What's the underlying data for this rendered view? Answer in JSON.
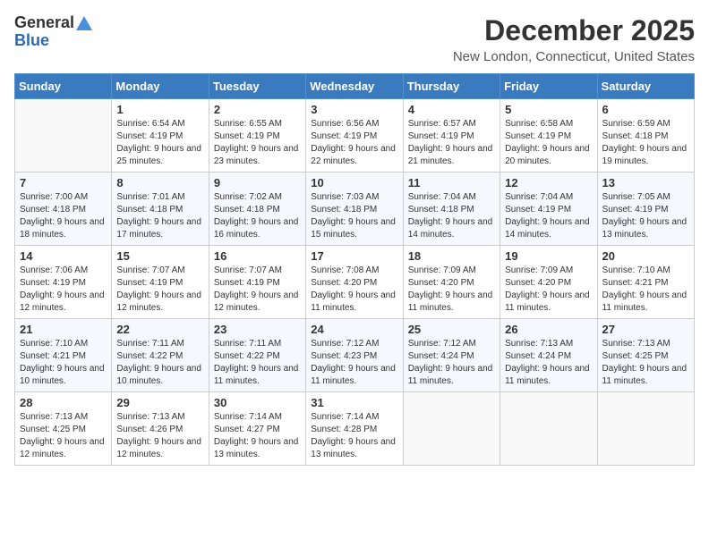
{
  "logo": {
    "general": "General",
    "blue": "Blue"
  },
  "header": {
    "title": "December 2025",
    "location": "New London, Connecticut, United States"
  },
  "weekdays": [
    "Sunday",
    "Monday",
    "Tuesday",
    "Wednesday",
    "Thursday",
    "Friday",
    "Saturday"
  ],
  "weeks": [
    [
      {
        "day": "",
        "sunrise": "",
        "sunset": "",
        "daylight": ""
      },
      {
        "day": "1",
        "sunrise": "Sunrise: 6:54 AM",
        "sunset": "Sunset: 4:19 PM",
        "daylight": "Daylight: 9 hours and 25 minutes."
      },
      {
        "day": "2",
        "sunrise": "Sunrise: 6:55 AM",
        "sunset": "Sunset: 4:19 PM",
        "daylight": "Daylight: 9 hours and 23 minutes."
      },
      {
        "day": "3",
        "sunrise": "Sunrise: 6:56 AM",
        "sunset": "Sunset: 4:19 PM",
        "daylight": "Daylight: 9 hours and 22 minutes."
      },
      {
        "day": "4",
        "sunrise": "Sunrise: 6:57 AM",
        "sunset": "Sunset: 4:19 PM",
        "daylight": "Daylight: 9 hours and 21 minutes."
      },
      {
        "day": "5",
        "sunrise": "Sunrise: 6:58 AM",
        "sunset": "Sunset: 4:19 PM",
        "daylight": "Daylight: 9 hours and 20 minutes."
      },
      {
        "day": "6",
        "sunrise": "Sunrise: 6:59 AM",
        "sunset": "Sunset: 4:18 PM",
        "daylight": "Daylight: 9 hours and 19 minutes."
      }
    ],
    [
      {
        "day": "7",
        "sunrise": "Sunrise: 7:00 AM",
        "sunset": "Sunset: 4:18 PM",
        "daylight": "Daylight: 9 hours and 18 minutes."
      },
      {
        "day": "8",
        "sunrise": "Sunrise: 7:01 AM",
        "sunset": "Sunset: 4:18 PM",
        "daylight": "Daylight: 9 hours and 17 minutes."
      },
      {
        "day": "9",
        "sunrise": "Sunrise: 7:02 AM",
        "sunset": "Sunset: 4:18 PM",
        "daylight": "Daylight: 9 hours and 16 minutes."
      },
      {
        "day": "10",
        "sunrise": "Sunrise: 7:03 AM",
        "sunset": "Sunset: 4:18 PM",
        "daylight": "Daylight: 9 hours and 15 minutes."
      },
      {
        "day": "11",
        "sunrise": "Sunrise: 7:04 AM",
        "sunset": "Sunset: 4:18 PM",
        "daylight": "Daylight: 9 hours and 14 minutes."
      },
      {
        "day": "12",
        "sunrise": "Sunrise: 7:04 AM",
        "sunset": "Sunset: 4:19 PM",
        "daylight": "Daylight: 9 hours and 14 minutes."
      },
      {
        "day": "13",
        "sunrise": "Sunrise: 7:05 AM",
        "sunset": "Sunset: 4:19 PM",
        "daylight": "Daylight: 9 hours and 13 minutes."
      }
    ],
    [
      {
        "day": "14",
        "sunrise": "Sunrise: 7:06 AM",
        "sunset": "Sunset: 4:19 PM",
        "daylight": "Daylight: 9 hours and 12 minutes."
      },
      {
        "day": "15",
        "sunrise": "Sunrise: 7:07 AM",
        "sunset": "Sunset: 4:19 PM",
        "daylight": "Daylight: 9 hours and 12 minutes."
      },
      {
        "day": "16",
        "sunrise": "Sunrise: 7:07 AM",
        "sunset": "Sunset: 4:19 PM",
        "daylight": "Daylight: 9 hours and 12 minutes."
      },
      {
        "day": "17",
        "sunrise": "Sunrise: 7:08 AM",
        "sunset": "Sunset: 4:20 PM",
        "daylight": "Daylight: 9 hours and 11 minutes."
      },
      {
        "day": "18",
        "sunrise": "Sunrise: 7:09 AM",
        "sunset": "Sunset: 4:20 PM",
        "daylight": "Daylight: 9 hours and 11 minutes."
      },
      {
        "day": "19",
        "sunrise": "Sunrise: 7:09 AM",
        "sunset": "Sunset: 4:20 PM",
        "daylight": "Daylight: 9 hours and 11 minutes."
      },
      {
        "day": "20",
        "sunrise": "Sunrise: 7:10 AM",
        "sunset": "Sunset: 4:21 PM",
        "daylight": "Daylight: 9 hours and 11 minutes."
      }
    ],
    [
      {
        "day": "21",
        "sunrise": "Sunrise: 7:10 AM",
        "sunset": "Sunset: 4:21 PM",
        "daylight": "Daylight: 9 hours and 10 minutes."
      },
      {
        "day": "22",
        "sunrise": "Sunrise: 7:11 AM",
        "sunset": "Sunset: 4:22 PM",
        "daylight": "Daylight: 9 hours and 10 minutes."
      },
      {
        "day": "23",
        "sunrise": "Sunrise: 7:11 AM",
        "sunset": "Sunset: 4:22 PM",
        "daylight": "Daylight: 9 hours and 11 minutes."
      },
      {
        "day": "24",
        "sunrise": "Sunrise: 7:12 AM",
        "sunset": "Sunset: 4:23 PM",
        "daylight": "Daylight: 9 hours and 11 minutes."
      },
      {
        "day": "25",
        "sunrise": "Sunrise: 7:12 AM",
        "sunset": "Sunset: 4:24 PM",
        "daylight": "Daylight: 9 hours and 11 minutes."
      },
      {
        "day": "26",
        "sunrise": "Sunrise: 7:13 AM",
        "sunset": "Sunset: 4:24 PM",
        "daylight": "Daylight: 9 hours and 11 minutes."
      },
      {
        "day": "27",
        "sunrise": "Sunrise: 7:13 AM",
        "sunset": "Sunset: 4:25 PM",
        "daylight": "Daylight: 9 hours and 11 minutes."
      }
    ],
    [
      {
        "day": "28",
        "sunrise": "Sunrise: 7:13 AM",
        "sunset": "Sunset: 4:25 PM",
        "daylight": "Daylight: 9 hours and 12 minutes."
      },
      {
        "day": "29",
        "sunrise": "Sunrise: 7:13 AM",
        "sunset": "Sunset: 4:26 PM",
        "daylight": "Daylight: 9 hours and 12 minutes."
      },
      {
        "day": "30",
        "sunrise": "Sunrise: 7:14 AM",
        "sunset": "Sunset: 4:27 PM",
        "daylight": "Daylight: 9 hours and 13 minutes."
      },
      {
        "day": "31",
        "sunrise": "Sunrise: 7:14 AM",
        "sunset": "Sunset: 4:28 PM",
        "daylight": "Daylight: 9 hours and 13 minutes."
      },
      {
        "day": "",
        "sunrise": "",
        "sunset": "",
        "daylight": ""
      },
      {
        "day": "",
        "sunrise": "",
        "sunset": "",
        "daylight": ""
      },
      {
        "day": "",
        "sunrise": "",
        "sunset": "",
        "daylight": ""
      }
    ]
  ]
}
